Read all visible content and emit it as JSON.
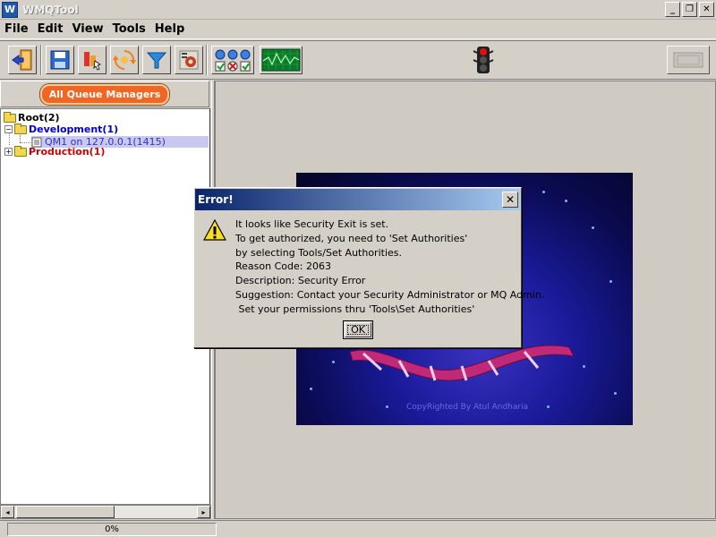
{
  "window": {
    "title": "WMQTool",
    "icon_letter": "W",
    "minimize": "_",
    "restore": "❐",
    "close": "✕"
  },
  "menu": [
    "File",
    "Edit",
    "View",
    "Tools",
    "Help"
  ],
  "toolbar": {
    "icons": [
      "exit-icon",
      "save-icon",
      "queue-manager-icon",
      "refresh-icon",
      "filter-icon",
      "settings-icon",
      "status-lights-icon",
      "monitor-icon",
      "traffic-light-icon"
    ]
  },
  "left": {
    "all_queue_managers": "All Queue Managers",
    "tree": {
      "root": "Root(2)",
      "development": "Development(1)",
      "qm1": "QM1  on 127.0.0.1(1415)",
      "production": "Production(1)"
    },
    "scroll_left": "◂",
    "scroll_right": "▸"
  },
  "splash": {
    "copyright": "CopyRighted By Atul Andharia"
  },
  "status": {
    "progress_text": "0%",
    "progress": 0
  },
  "dialog": {
    "title": "Error!",
    "close": "✕",
    "lines": [
      "It looks like Security Exit is set.",
      "To get authorized, you need to 'Set Authorities'",
      "by selecting Tools/Set Authorities.",
      "Reason Code: 2063",
      "Description: Security Error",
      "Suggestion: Contact your Security Administrator or MQ Admin.",
      " Set your permissions thru 'Tools\\Set Authorities'"
    ],
    "ok": "OK"
  },
  "colors": {
    "development": "#0000c8",
    "production": "#d00000",
    "qm_selected_bg": "#c8c8f0",
    "qm_text": "#3030c0"
  }
}
